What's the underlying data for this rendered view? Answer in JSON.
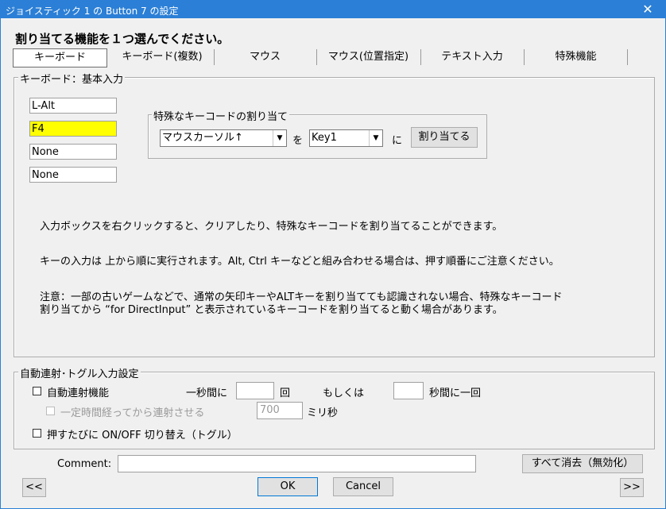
{
  "window": {
    "title": "ジョイスティック 1 の Button 7 の設定",
    "close_glyph": "✕"
  },
  "instruction": "割り当てる機能を１つ選んでください。",
  "tabs": [
    {
      "label": "キーボード",
      "active": true
    },
    {
      "label": "キーボード(複数)"
    },
    {
      "label": "マウス"
    },
    {
      "label": "マウス(位置指定)"
    },
    {
      "label": "テキスト入力"
    },
    {
      "label": "特殊機能"
    }
  ],
  "keyboard_group": {
    "label": "キーボード：基本入力",
    "key_inputs": [
      {
        "value": "L-Alt",
        "highlight": false
      },
      {
        "value": "F4",
        "highlight": true
      },
      {
        "value": "None",
        "highlight": false
      },
      {
        "value": "None",
        "highlight": false
      }
    ],
    "highlight_color": "#ffff00",
    "special": {
      "label": "特殊なキーコードの割り当て",
      "source_select": "マウスカーソル↑",
      "wo": "を",
      "target_select": "Key1",
      "ni": "に",
      "assign_button": "割り当てる"
    },
    "notes": [
      "入力ボックスを右クリックすると、クリアしたり、特殊なキーコードを割り当てることができます。",
      "キーの入力は 上から順に実行されます。Alt, Ctrl キーなどと組み合わせる場合は、押す順番にご注意ください。",
      "注意：一部の古いゲームなどで、通常の矢印キーやALTキーを割り当てても認識されない場合、特殊なキーコード",
      "割り当てから “for DirectInput” と表示されているキーコードを割り当てると動く場合があります。"
    ]
  },
  "auto_group": {
    "label": "自動連射･トグル入力設定",
    "autofire_label": "自動連射機能",
    "per_second_label": "一秒間に",
    "per_second_value": "",
    "times_label": "回",
    "or_label": "もしくは",
    "seconds_value": "",
    "seconds_label": "秒間に一回",
    "delay_label": "一定時間経ってから連射させる",
    "delay_value": "700",
    "ms_label": "ミリ秒",
    "toggle_label": "押すたびに ON/OFF 切り替え（トグル）"
  },
  "footer": {
    "comment_label": "Comment:",
    "comment_value": "",
    "clear_all_button": "すべて消去（無効化）",
    "prev_button": "<<",
    "ok_button": "OK",
    "cancel_button": "Cancel",
    "next_button": ">>"
  }
}
